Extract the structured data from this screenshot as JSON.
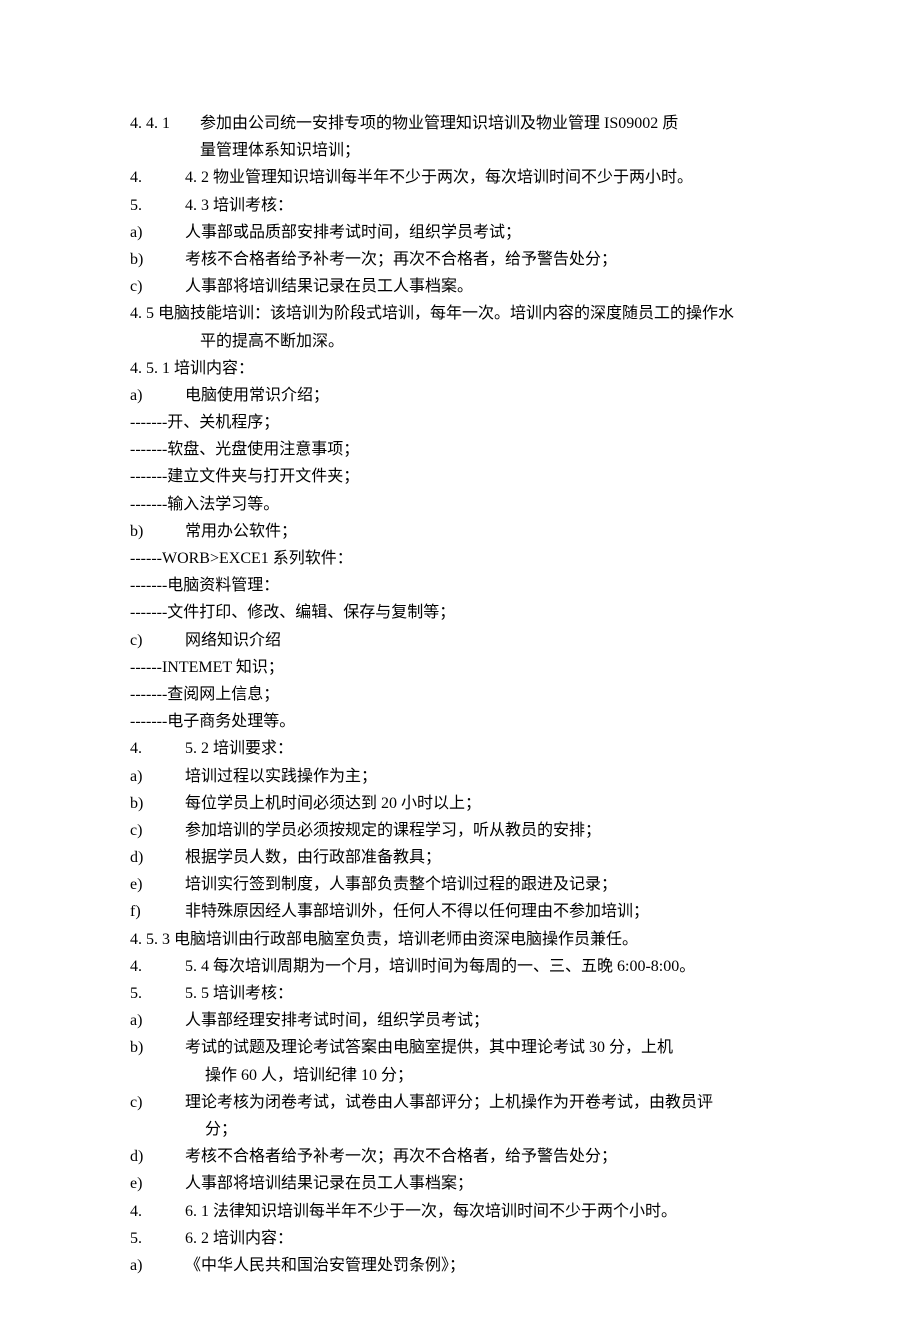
{
  "items": [
    {
      "label": "4. 4. 1",
      "text": "参加由公司统一安排专项的物业管理知识培训及物业管理 IS09002 质",
      "labelWide": true
    },
    {
      "label": "",
      "text": "量管理体系知识培训；",
      "indent": true,
      "labelWide": true
    },
    {
      "label": "4.",
      "text": "4. 2 物业管理知识培训每半年不少于两次，每次培训时间不少于两小时。"
    },
    {
      "label": "5.",
      "text": "4. 3 培训考核："
    },
    {
      "label": "a)",
      "text": "人事部或品质部安排考试时间，组织学员考试；"
    },
    {
      "label": "b)",
      "text": "考核不合格者给予补考一次；再次不合格者，给予警告处分；"
    },
    {
      "label": "c)",
      "text": "人事部将培训结果记录在员工人事档案。"
    },
    {
      "label": "4. 5",
      "text": "电脑技能培训：该培训为阶段式培训，每年一次。培训内容的深度随员工的操作水",
      "noindent": true
    },
    {
      "label": "",
      "text": "平的提高不断加深。",
      "indent": true,
      "labelWide": true
    },
    {
      "label": "4. 5. 1",
      "text": "培训内容：",
      "noindent": true
    },
    {
      "label": "a)",
      "text": "电脑使用常识介绍；"
    },
    {
      "label": "-------开、关机程序；",
      "full": true
    },
    {
      "label": "-------软盘、光盘使用注意事项；",
      "full": true
    },
    {
      "label": "-------建立文件夹与打开文件夹；",
      "full": true
    },
    {
      "label": "-------输入法学习等。",
      "full": true
    },
    {
      "label": "b)",
      "text": "常用办公软件；"
    },
    {
      "label": " ------WORB>EXCE1 系列软件：",
      "full": true
    },
    {
      "label": "-------电脑资料管理：",
      "full": true
    },
    {
      "label": "-------文件打印、修改、编辑、保存与复制等；",
      "full": true
    },
    {
      "label": "c)",
      "text": "网络知识介绍"
    },
    {
      "label": " ------INTEMET 知识；",
      "full": true
    },
    {
      "label": "-------查阅网上信息；",
      "full": true
    },
    {
      "label": "-------电子商务处理等。",
      "full": true
    },
    {
      "label": "4.",
      "text": "5. 2 培训要求："
    },
    {
      "label": "a)",
      "text": "培训过程以实践操作为主；"
    },
    {
      "label": "b)",
      "text": "每位学员上机时间必须达到 20 小时以上；"
    },
    {
      "label": "c)",
      "text": "参加培训的学员必须按规定的课程学习，听从教员的安排；"
    },
    {
      "label": "d)",
      "text": "根据学员人数，由行政部准备教具；"
    },
    {
      "label": "e)",
      "text": "培训实行签到制度，人事部负责整个培训过程的跟进及记录；"
    },
    {
      "label": "f)",
      "text": "非特殊原因经人事部培训外，任何人不得以任何理由不参加培训；"
    },
    {
      "label": "4. 5. 3",
      "text": "电脑培训由行政部电脑室负责，培训老师由资深电脑操作员兼任。",
      "noindent": true
    },
    {
      "label": "4.",
      "text": "5. 4 每次培训周期为一个月，培训时间为每周的一、三、五晚 6:00-8:00。"
    },
    {
      "label": "5.",
      "text": "5. 5 培训考核："
    },
    {
      "label": "a)",
      "text": "人事部经理安排考试时间，组织学员考试；"
    },
    {
      "label": "b)",
      "text": "考试的试题及理论考试答案由电脑室提供，其中理论考试 30 分，上机"
    },
    {
      "label": "",
      "text": "操作 60 人，培训纪律 10 分；",
      "indent2": true
    },
    {
      "label": "c)",
      "text": "理论考核为闭卷考试，试卷由人事部评分；上机操作为开卷考试，由教员评"
    },
    {
      "label": "",
      "text": "分；",
      "indent2": true
    },
    {
      "label": "d)",
      "text": "考核不合格者给予补考一次；再次不合格者，给予警告处分；"
    },
    {
      "label": "e)",
      "text": "人事部将培训结果记录在员工人事档案；"
    },
    {
      "label": "4.",
      "text": "6. 1 法律知识培训每半年不少于一次，每次培训时间不少于两个小时。"
    },
    {
      "label": "5.",
      "text": "6. 2 培训内容："
    },
    {
      "label": "a)",
      "text": "《中华人民共和国治安管理处罚条例》；"
    }
  ]
}
